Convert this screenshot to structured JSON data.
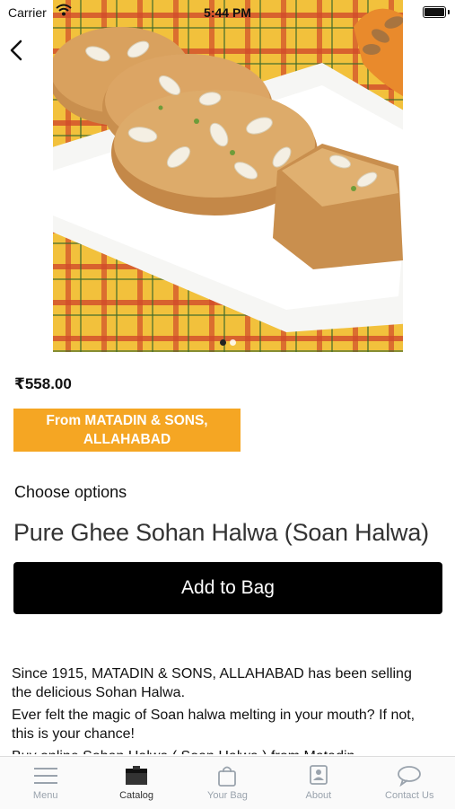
{
  "status": {
    "carrier": "Carrier",
    "time": "5:44 PM"
  },
  "product": {
    "price": "₹558.00",
    "vendor": "From MATADIN & SONS, ALLAHABAD",
    "choose_options": "Choose options",
    "name": "Pure Ghee Sohan Halwa (Soan Halwa)",
    "add_to_bag": "Add to Bag",
    "description": [
      "Since 1915,  MATADIN & SONS, ALLAHABAD has been selling the delicious Sohan Halwa.",
      "Ever felt the magic of Soan halwa melting in your mouth? If not, this is your chance!",
      "Buy online Sohan Halwa ( Soan Halwa ) from Matadin"
    ],
    "image_count": 2,
    "image_index": 1
  },
  "tabs": [
    {
      "label": "Menu",
      "icon": "menu-icon",
      "active": false
    },
    {
      "label": "Catalog",
      "icon": "catalog-icon",
      "active": true
    },
    {
      "label": "Your Bag",
      "icon": "bag-icon",
      "active": false
    },
    {
      "label": "About",
      "icon": "about-icon",
      "active": false
    },
    {
      "label": "Contact Us",
      "icon": "chat-icon",
      "active": false
    }
  ],
  "colors": {
    "accent": "#f5a623",
    "button": "#000000",
    "tab_inactive": "#9aa3ad"
  }
}
